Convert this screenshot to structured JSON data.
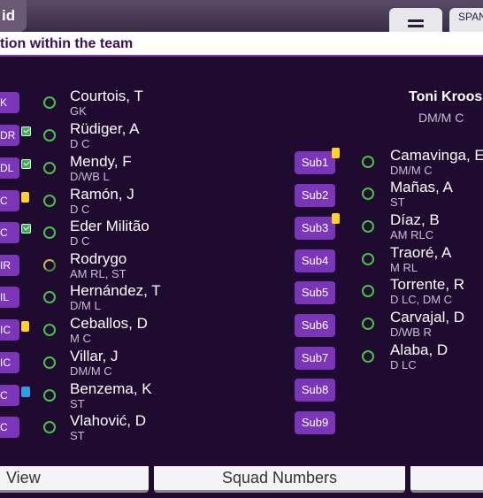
{
  "top_bar": {
    "tab_fragment": "id",
    "language_button": "SPAN"
  },
  "header": {
    "title": "tion within the team"
  },
  "selected_player": {
    "name": "Toni Kroos",
    "position": "DM/M C"
  },
  "starters": [
    {
      "pos_label": "K",
      "name": "Courtois, T",
      "positions": "GK",
      "badge": "",
      "ring": "full"
    },
    {
      "pos_label": "DR",
      "name": "Rüdiger, A",
      "positions": "D C",
      "badge": "green",
      "ring": "full"
    },
    {
      "pos_label": "DL",
      "name": "Mendy, F",
      "positions": "D/WB L",
      "badge": "green",
      "ring": "full"
    },
    {
      "pos_label": "C",
      "name": "Ramón, J",
      "positions": "D C",
      "badge": "yellow",
      "ring": "full"
    },
    {
      "pos_label": "C",
      "name": "Eder Militão",
      "positions": "D C",
      "badge": "green",
      "ring": "full"
    },
    {
      "pos_label": "IR",
      "name": "Rodrygo",
      "positions": "AM RL, ST",
      "badge": "",
      "ring": "half"
    },
    {
      "pos_label": "IL",
      "name": "Hernández, T",
      "positions": "D/M L",
      "badge": "",
      "ring": "full"
    },
    {
      "pos_label": "IC",
      "name": "Ceballos, D",
      "positions": "M C",
      "badge": "yellow",
      "ring": "full"
    },
    {
      "pos_label": "IC",
      "name": "Villar, J",
      "positions": "DM/M C",
      "badge": "",
      "ring": "full"
    },
    {
      "pos_label": "C",
      "name": "Benzema, K",
      "positions": "ST",
      "badge": "blue",
      "ring": "full"
    },
    {
      "pos_label": "C",
      "name": "Vlahović, D",
      "positions": "ST",
      "badge": "",
      "ring": "full"
    }
  ],
  "sub_slots": [
    {
      "label": "Sub1",
      "badge": "yellow"
    },
    {
      "label": "Sub2",
      "badge": ""
    },
    {
      "label": "Sub3",
      "badge": "yellow"
    },
    {
      "label": "Sub4",
      "badge": ""
    },
    {
      "label": "Sub5",
      "badge": ""
    },
    {
      "label": "Sub6",
      "badge": ""
    },
    {
      "label": "Sub7",
      "badge": ""
    },
    {
      "label": "Sub8",
      "badge": ""
    },
    {
      "label": "Sub9",
      "badge": ""
    }
  ],
  "substitutes": [
    {
      "name": "Camavinga, E",
      "positions": "DM/M C"
    },
    {
      "name": "Mañas, A",
      "positions": "ST"
    },
    {
      "name": "Díaz, B",
      "positions": "AM RLC"
    },
    {
      "name": "Traoré, A",
      "positions": "M RL"
    },
    {
      "name": "Torrente, R",
      "positions": "D LC, DM C"
    },
    {
      "name": "Carvajal, D",
      "positions": "D/WB R"
    },
    {
      "name": "Alaba, D",
      "positions": "D LC"
    }
  ],
  "bottom_bar": {
    "view_label": "View",
    "squad_numbers_label": "Squad Numbers"
  },
  "colors": {
    "background": "#1f0a30",
    "button_purple": "#7b35b8",
    "ring_green": "#46c246",
    "badge_yellow": "#ffd21f",
    "badge_green": "#37b24d",
    "badge_blue": "#2f9ee8"
  }
}
